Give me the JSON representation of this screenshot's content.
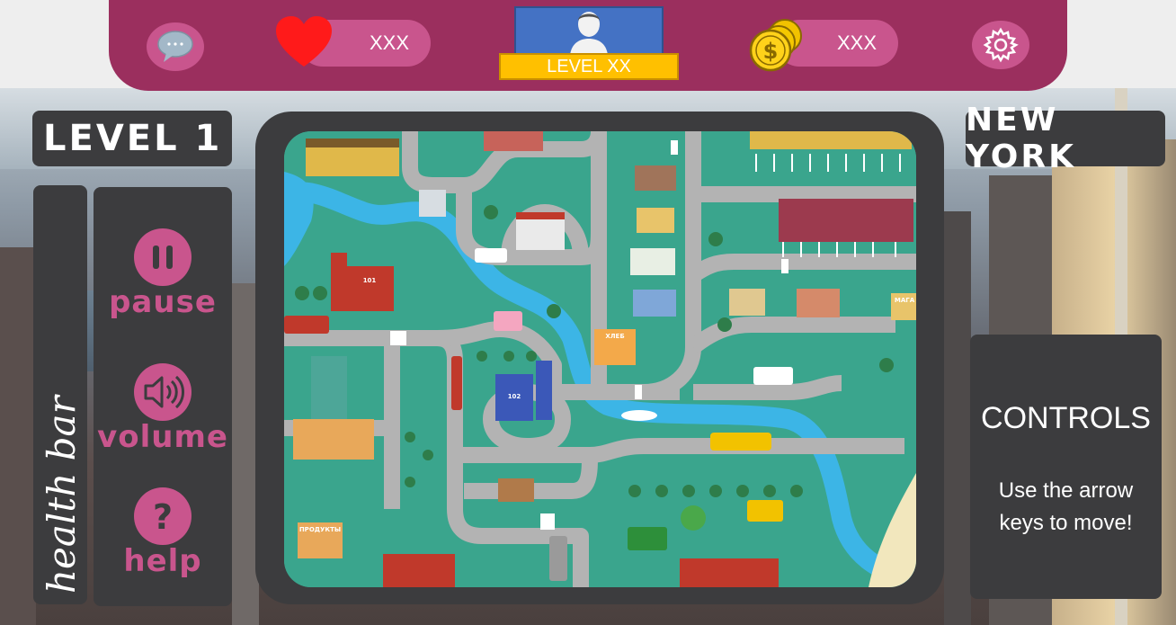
{
  "hud": {
    "lives_value": "XXX",
    "coins_value": "XXX",
    "player_level": "LEVEL XX"
  },
  "game": {
    "level_label": "LEVEL 1",
    "city_name": "NEW YORK",
    "health_label": "health bar"
  },
  "menu": {
    "pause_label": "pause",
    "volume_label": "volume",
    "help_label": "help"
  },
  "controls": {
    "title": "CONTROLS",
    "text": "Use the arrow keys to move!"
  },
  "map_signs": {
    "bakery": "ХЛЕБ",
    "grocery": "ПРОДУКТЫ",
    "shop": "МАГА",
    "fire_station_no": "101",
    "police_station_no": "102"
  },
  "colors": {
    "topbar": "#9b2f5e",
    "accent_pink": "#c9558d",
    "panel_dark": "#3c3c3e",
    "avatar_blue": "#4472c4",
    "level_gold": "#ffc000",
    "map_green": "#3aa58d",
    "road_gray": "#b3b3b3",
    "river_blue": "#3cb5e6"
  }
}
